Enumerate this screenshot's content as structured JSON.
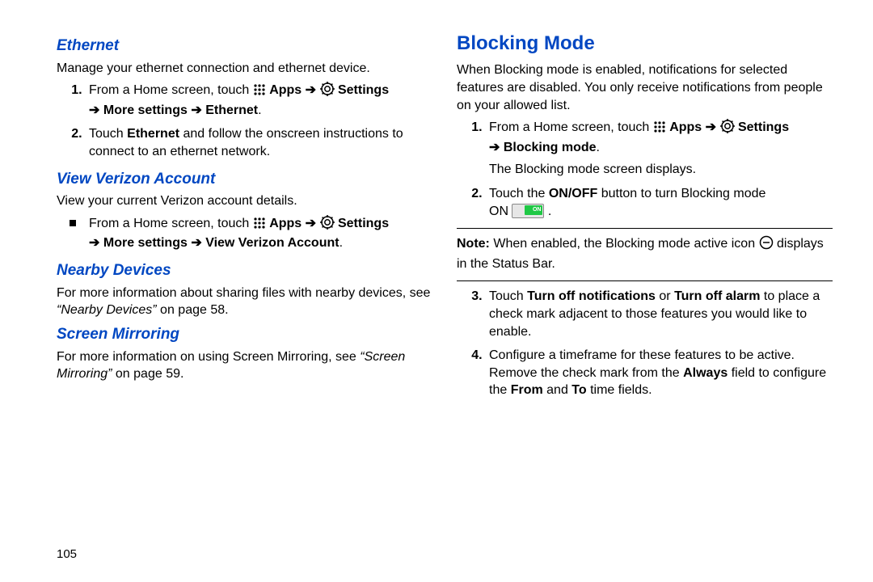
{
  "pageNumber": "105",
  "left": {
    "ethernet": {
      "title": "Ethernet",
      "desc": "Manage your ethernet connection and ethernet device.",
      "step1_a": "From a Home screen, touch ",
      "apps": "Apps",
      "settings": "Settings",
      "step1_b": " More settings ",
      "step1_c": " Ethernet",
      "step2_a": "Touch ",
      "step2_b": "Ethernet",
      "step2_c": " and follow the onscreen instructions to connect to an ethernet network."
    },
    "verizon": {
      "title": "View Verizon Account",
      "desc": "View your current Verizon account details.",
      "step1_a": "From a Home screen, touch ",
      "apps": "Apps",
      "settings": "Settings",
      "step1_b": " More settings ",
      "step1_c": " View Verizon Account"
    },
    "nearby": {
      "title": "Nearby Devices",
      "line_a": "For more information about sharing files with nearby devices, see ",
      "ref": "“Nearby Devices”",
      "line_b": " on page 58."
    },
    "mirror": {
      "title": "Screen Mirroring",
      "line_a": "For more information on using Screen Mirroring, see ",
      "ref": "“Screen Mirroring”",
      "line_b": " on page 59."
    }
  },
  "right": {
    "blocking": {
      "title": "Blocking Mode",
      "desc": "When Blocking mode is enabled, notifications for selected features are disabled. You only receive notifications from people on your allowed list.",
      "step1_a": "From a Home screen, touch ",
      "apps": "Apps",
      "settings": "Settings",
      "step1_b": " Blocking mode",
      "step1_sub": "The Blocking mode screen displays.",
      "step2_a": "Touch the ",
      "step2_b": "ON/OFF",
      "step2_c": " button to turn Blocking mode ",
      "step2_d": "ON",
      "on_label": "ON",
      "note_a": "Note:",
      "note_b": " When enabled, the Blocking mode active icon ",
      "note_c": " displays in the Status Bar.",
      "step3_a": "Touch ",
      "step3_b": "Turn off notifications",
      "step3_or": " or ",
      "step3_c": "Turn off alarm",
      "step3_d": " to place a check mark adjacent to those features you would like to enable.",
      "step4_a": "Configure a timeframe for these features to be active. Remove the check mark from the ",
      "step4_b": "Always",
      "step4_c": " field to configure the ",
      "step4_d": "From",
      "step4_e": " and ",
      "step4_f": "To",
      "step4_g": " time fields."
    }
  }
}
